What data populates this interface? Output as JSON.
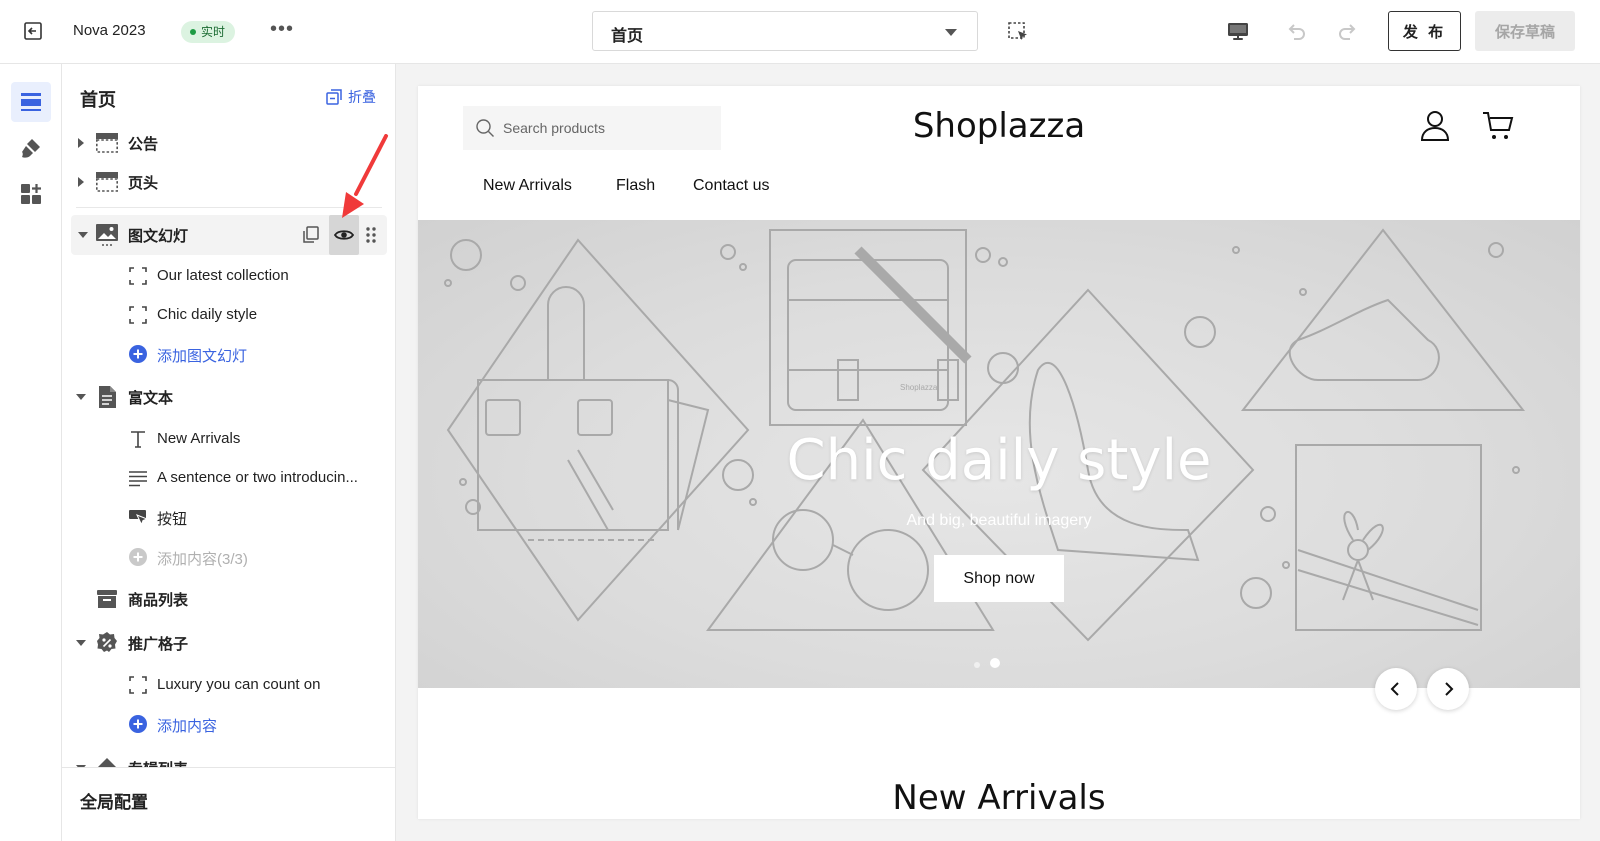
{
  "topbar": {
    "theme_name": "Nova 2023",
    "live_badge": "实时",
    "more": "•••",
    "page_select": "首页",
    "publish_label": "发 布",
    "save_draft_label": "保存草稿"
  },
  "sidebar": {
    "title": "首页",
    "collapse_label": "折叠",
    "sections": [
      {
        "label": "公告",
        "icon": "announcement-icon",
        "expanded": false
      },
      {
        "label": "页头",
        "icon": "header-icon",
        "expanded": false
      },
      {
        "label": "图文幻灯",
        "icon": "slideshow-icon",
        "expanded": true,
        "selected": true,
        "children": [
          {
            "label": "Our latest collection",
            "icon": "block-frame-icon"
          },
          {
            "label": "Chic daily style",
            "icon": "block-frame-icon"
          },
          {
            "label": "添加图文幻灯",
            "icon": "add-circle-icon",
            "add": true
          }
        ]
      },
      {
        "label": "富文本",
        "icon": "rich-text-icon",
        "expanded": true,
        "children": [
          {
            "label": "New Arrivals",
            "icon": "text-heading-icon"
          },
          {
            "label": "A sentence or two introducin...",
            "icon": "paragraph-icon"
          },
          {
            "label": "按钮",
            "icon": "button-cursor-icon"
          },
          {
            "label": "添加内容(3/3)",
            "icon": "add-circle-icon",
            "disabled": true
          }
        ]
      },
      {
        "label": "商品列表",
        "icon": "product-list-icon",
        "expanded": false
      },
      {
        "label": "推广格子",
        "icon": "promo-grid-icon",
        "expanded": true,
        "children": [
          {
            "label": "Luxury you can count on",
            "icon": "block-frame-icon"
          },
          {
            "label": "添加内容",
            "icon": "add-circle-icon",
            "add": true
          }
        ]
      },
      {
        "label": "专辑列表",
        "icon": "collection-list-icon",
        "expanded": true
      }
    ],
    "footer_label": "全局配置"
  },
  "preview": {
    "search_placeholder": "Search products",
    "logo": "Shoplazza",
    "nav": [
      "New Arrivals",
      "Flash",
      "Contact us"
    ],
    "hero_title": "Chic daily style",
    "hero_subtitle": "And big, beautiful imagery",
    "hero_button": "Shop now",
    "hero_watermark": "Shoplazza",
    "section_title": "New Arrivals"
  },
  "colors": {
    "accent": "#3a63e0",
    "live_bg": "#dcf3e1",
    "live_dot": "#1d9b43",
    "annotation_arrow": "#f03a3a"
  }
}
